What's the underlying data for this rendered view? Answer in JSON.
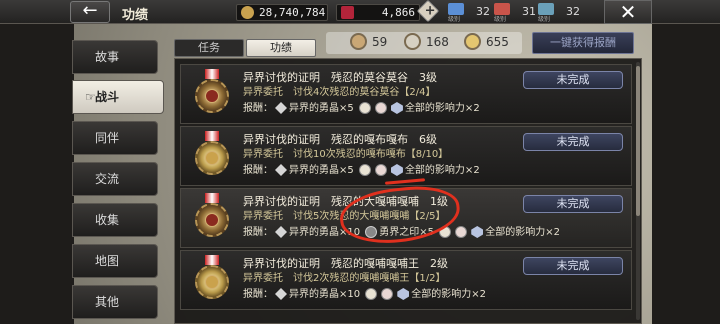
{
  "header": {
    "back_label": "←",
    "title": "功绩",
    "gold": "28,740,784",
    "gems": "4,866",
    "grades": [
      {
        "label": "级别",
        "value": "32",
        "color": "#5b8fd6"
      },
      {
        "label": "级别",
        "value": "31",
        "color": "#c9544a"
      },
      {
        "label": "级别",
        "value": "32",
        "color": "#6aa0b9"
      }
    ],
    "close_label": "✕"
  },
  "sidebar": {
    "items": [
      {
        "label": "故事",
        "active": false
      },
      {
        "label": "战斗",
        "active": true
      },
      {
        "label": "同伴",
        "active": false
      },
      {
        "label": "交流",
        "active": false
      },
      {
        "label": "收集",
        "active": false
      },
      {
        "label": "地图",
        "active": false
      },
      {
        "label": "其他",
        "active": false
      }
    ]
  },
  "tabs": [
    {
      "label": "任务",
      "active": false
    },
    {
      "label": "功绩",
      "active": true
    }
  ],
  "medal_counts": [
    "59",
    "168",
    "655"
  ],
  "claim_all_label": "一键获得报酬",
  "rows": [
    {
      "title": "异界讨伐的证明　残忍的莫谷莫谷　3级",
      "desc": "异界委托　讨伐4次残忍的莫谷莫谷【2/4】",
      "reward_label": "报酬：",
      "reward_a": "异界的勇晶×5",
      "reward_b": "全部的影响力×2",
      "status": "未完成",
      "medal": "bronze"
    },
    {
      "title": "异界讨伐的证明　残忍的嘎布嘎布　6级",
      "desc": "异界委托　讨伐10次残忍的嘎布嘎布【8/10】",
      "reward_label": "报酬：",
      "reward_a": "异界的勇晶×5",
      "reward_b": "全部的影响力×2",
      "status": "未完成",
      "medal": "gold"
    },
    {
      "title": "异界讨伐的证明　残忍的大嘎哺嘎哺　1级",
      "desc": "异界委托　讨伐5次残忍的大嘎哺嘎哺【2/5】",
      "reward_label": "报酬：",
      "reward_a": "异界的勇晶×10",
      "reward_c": "勇界之印×5",
      "reward_b": "全部的影响力×2",
      "status": "未完成",
      "medal": "bronze"
    },
    {
      "title": "异界讨伐的证明　残忍的嘎哺嘎哺王　2级",
      "desc": "异界委托　讨伐2次残忍的嘎哺嘎哺王【1/2】",
      "reward_label": "报酬：",
      "reward_a": "异界的勇晶×10",
      "reward_b": "全部的影响力×2",
      "status": "未完成",
      "medal": "gold"
    }
  ]
}
